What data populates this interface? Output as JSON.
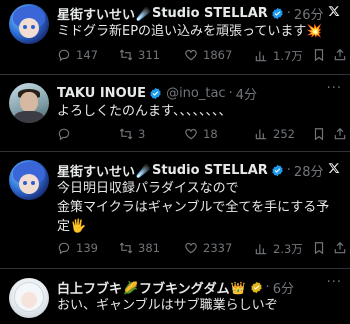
{
  "posts": [
    {
      "author": "星街すいせい",
      "name_emoji": "☄️",
      "name_suffix": "Studio STELLAR",
      "separator": "·",
      "time": "26分",
      "text": "ミドグラ新EPの追い込みを頑張っています💥",
      "replies": "147",
      "reposts": "311",
      "likes": "1867",
      "views": "1.7万"
    },
    {
      "author": "TAKU INOUE",
      "handle": "@ino_tac",
      "separator": "·",
      "time": "4分",
      "text": "よろしくたのんます、、、、、、、、",
      "replies": "",
      "reposts": "3",
      "likes": "18",
      "views": "252"
    },
    {
      "author": "星街すいせい",
      "name_emoji": "☄️",
      "name_suffix": "Studio STELLAR",
      "separator": "·",
      "time": "28分",
      "text": "今日明日収録パラダイスなので\n金策マイクラはギャンブルで全てを手にする予\n定🖐️",
      "replies": "139",
      "reposts": "381",
      "likes": "2337",
      "views": "2.3万"
    },
    {
      "author": "白上フブキ",
      "name_emoji": "🌽",
      "name_suffix": "フブキングダム",
      "crown_emoji": "👑",
      "separator": "·",
      "time": "6分",
      "text": "おい、ギャンブルはサブ職業らしいぞ"
    }
  ],
  "icons": {
    "reply": "reply-icon",
    "repost": "repost-icon",
    "like": "like-icon",
    "views": "views-icon",
    "bookmark": "bookmark-icon",
    "share": "share-icon",
    "verified": "verified-badge-icon",
    "x_logo": "x-logo-icon"
  },
  "colors": {
    "background": "#000000",
    "text": "#e7e9ea",
    "muted": "#71767b",
    "verified_blue": "#1d9bf0",
    "verified_gold": "#e2b719",
    "divider": "#2f3336"
  }
}
